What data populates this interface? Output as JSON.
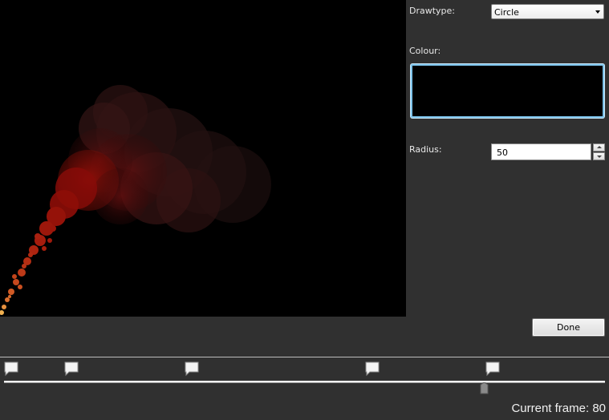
{
  "properties": {
    "drawtype_label": "Drawtype:",
    "drawtype_value": "Circle",
    "colour_label": "Colour:",
    "colour_value": "#000000",
    "radius_label": "Radius:",
    "radius_value": "50"
  },
  "actions": {
    "done_label": "Done"
  },
  "timeline": {
    "current_frame_label": "Current frame: 80",
    "keyframe_count": 5,
    "accent_color": "#f2f2f2"
  },
  "icons": {
    "dropdown": "chevron-down-icon",
    "spin_up": "spin-up-icon",
    "spin_down": "spin-down-icon",
    "keyframe": "keyframe-flag-icon",
    "playhead": "playhead-icon"
  }
}
